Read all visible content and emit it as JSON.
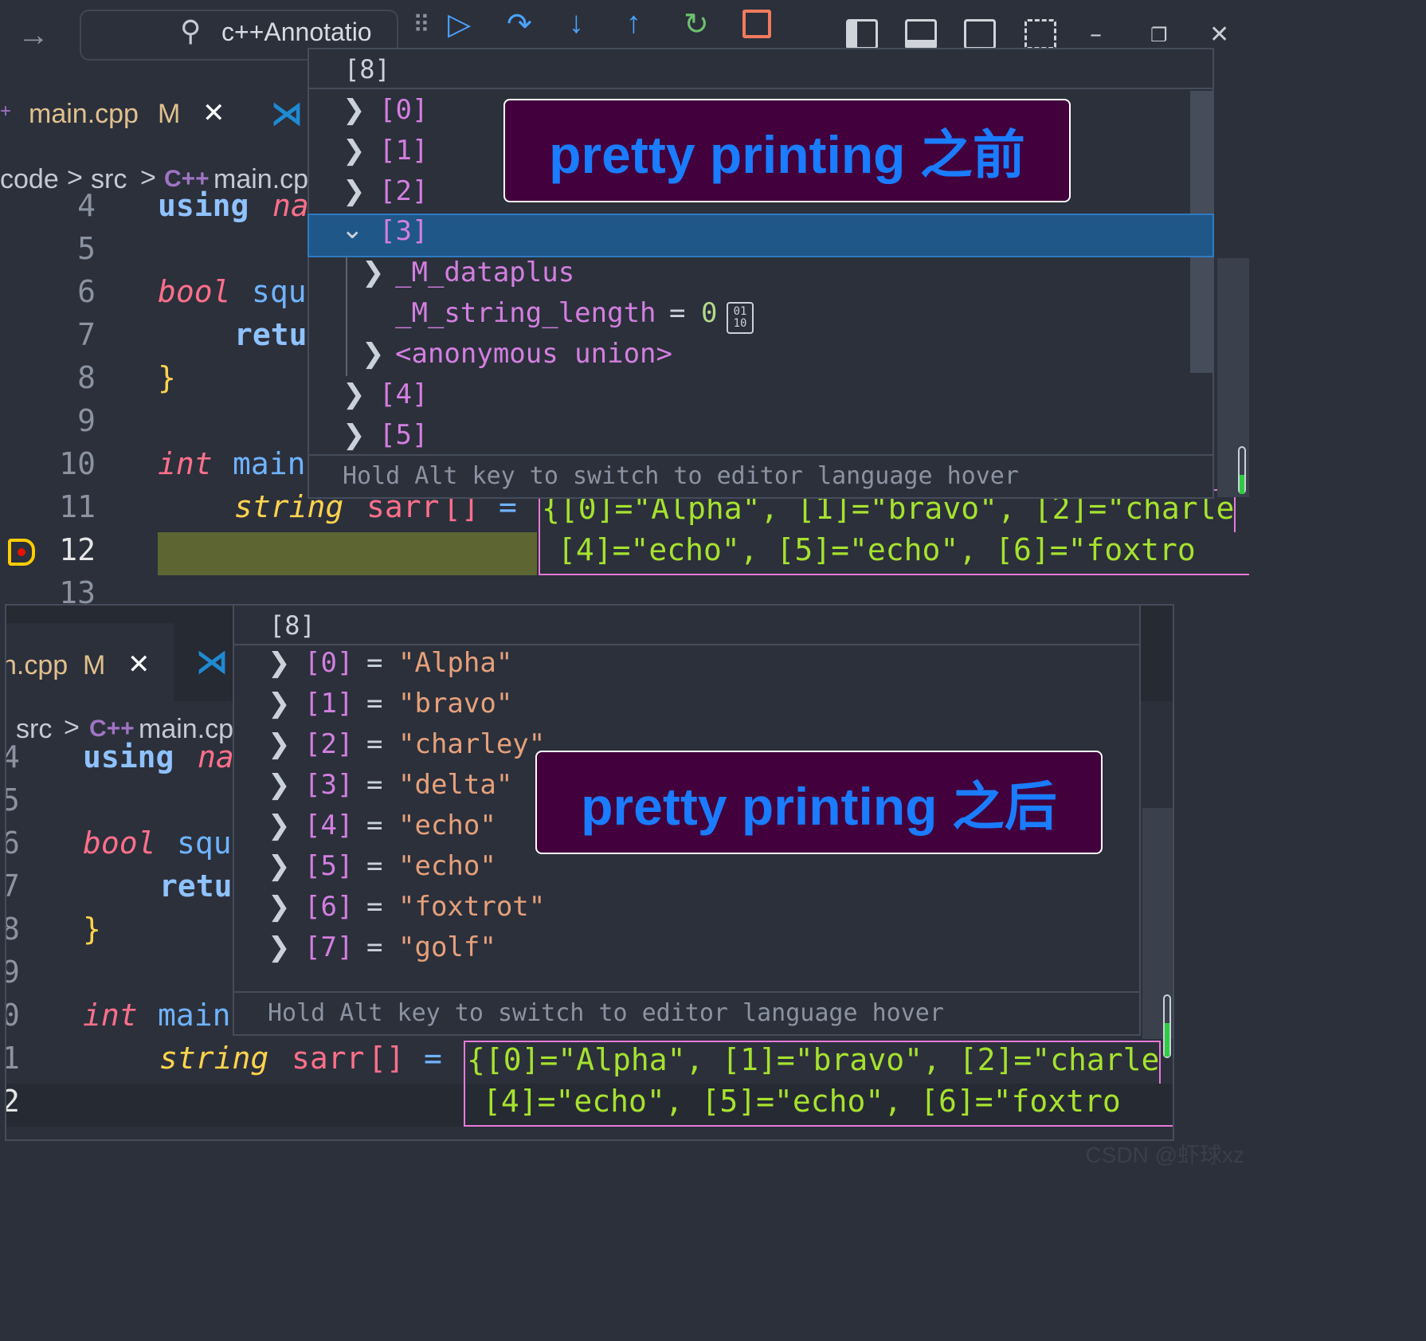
{
  "top": {
    "search_text": "c++Annotatio",
    "tab": {
      "filename": "main.cpp",
      "modified_badge": "M",
      "close_glyph": "✕"
    },
    "breadcrumbs": {
      "folder": "code",
      "sep": ">",
      "sub": "src",
      "file_icon": "C++",
      "file": "main.cp"
    },
    "code_lines": [
      {
        "num": "4",
        "text_a": "using",
        "text_b": "na"
      },
      {
        "num": "5"
      },
      {
        "num": "6",
        "text_a": "bool",
        "text_b": "squ"
      },
      {
        "num": "7",
        "text_a": "retu"
      },
      {
        "num": "8",
        "text_a": "}"
      },
      {
        "num": "9"
      },
      {
        "num": "10",
        "text_a": "int",
        "text_b": "main"
      },
      {
        "num": "11",
        "text_a": "string",
        "text_b": "sarr",
        "text_c": "[]",
        "text_d": "="
      },
      {
        "num": "12"
      },
      {
        "num": "13"
      }
    ],
    "inline_values_line11": "{[0]=\"Alpha\", [1]=\"bravo\", [2]=\"charle",
    "inline_values_line12": "[4]=\"echo\",  [5]=\"echo\",  [6]=\"foxtro",
    "hover": {
      "title": "[8]",
      "rows": [
        {
          "label": "[0]",
          "expanded": false
        },
        {
          "label": "[1]",
          "expanded": false
        },
        {
          "label": "[2]",
          "expanded": false
        },
        {
          "label": "[3]",
          "expanded": true
        },
        {
          "label": "_M_dataplus",
          "child": true,
          "expanded": false
        },
        {
          "label": "_M_string_length",
          "child": true,
          "value": "0",
          "eq": "="
        },
        {
          "label": "<anonymous union>",
          "child": true,
          "expanded": false
        },
        {
          "label": "[4]",
          "expanded": false
        },
        {
          "label": "[5]",
          "expanded": false
        }
      ],
      "footer": "Hold Alt key to switch to editor language hover",
      "binary_icon_text": "01\n10"
    },
    "overlay_label": "pretty printing 之前"
  },
  "bottom": {
    "tab": {
      "filename": "n.cpp",
      "modified_badge": "M",
      "close_glyph": "✕"
    },
    "breadcrumbs": {
      "sub": "src",
      "sep": ">",
      "file_icon": "C++",
      "file": "main.cp"
    },
    "code_lines": [
      {
        "num": "4",
        "text_a": "using",
        "text_b": "na"
      },
      {
        "num": "5"
      },
      {
        "num": "6",
        "text_a": "bool",
        "text_b": "squ"
      },
      {
        "num": "7",
        "text_a": "retu"
      },
      {
        "num": "8",
        "text_a": "}"
      },
      {
        "num": "9"
      },
      {
        "num": "0",
        "text_a": "int",
        "text_b": "main"
      },
      {
        "num": "1",
        "text_a": "string",
        "text_b": "sarr",
        "text_c": "[]",
        "text_d": "="
      },
      {
        "num": "2"
      }
    ],
    "inline_values_line11": "{[0]=\"Alpha\", [1]=\"bravo\", [2]=\"charle",
    "inline_values_line12": "[4]=\"echo\",  [5]=\"echo\",  [6]=\"foxtro",
    "hover": {
      "title": "[8]",
      "rows": [
        {
          "index": "[0]",
          "eq": "=",
          "value": "\"Alpha\""
        },
        {
          "index": "[1]",
          "eq": "=",
          "value": "\"bravo\""
        },
        {
          "index": "[2]",
          "eq": "=",
          "value": "\"charley\""
        },
        {
          "index": "[3]",
          "eq": "=",
          "value": "\"delta\""
        },
        {
          "index": "[4]",
          "eq": "=",
          "value": "\"echo\""
        },
        {
          "index": "[5]",
          "eq": "=",
          "value": "\"echo\""
        },
        {
          "index": "[6]",
          "eq": "=",
          "value": "\"foxtrot\""
        },
        {
          "index": "[7]",
          "eq": "=",
          "value": "\"golf\""
        }
      ],
      "footer": "Hold Alt key to switch to editor language hover"
    },
    "overlay_label": "pretty printing 之后"
  },
  "watermark": "CSDN @虾球xz",
  "colors": {
    "overlay_bg": "#42003d",
    "overlay_text": "#1a7cff",
    "selection": "#1f5788",
    "breakpoint_line": "#5d6532",
    "breakpoint_icon": "#ffcc00"
  },
  "icons": [
    "arrow-right-icon",
    "search-icon",
    "drag-handle-icon",
    "continue-icon",
    "step-over-icon",
    "step-into-icon",
    "step-out-icon",
    "restart-icon",
    "stop-icon",
    "toggle-primary-sidebar-icon",
    "toggle-panel-icon",
    "toggle-secondary-sidebar-icon",
    "customize-layout-icon",
    "minimize-icon",
    "restore-icon",
    "close-icon",
    "vscode-logo-icon",
    "chevron-right-icon",
    "chevron-down-icon",
    "breakpoint-current-icon",
    "binary-view-icon"
  ]
}
